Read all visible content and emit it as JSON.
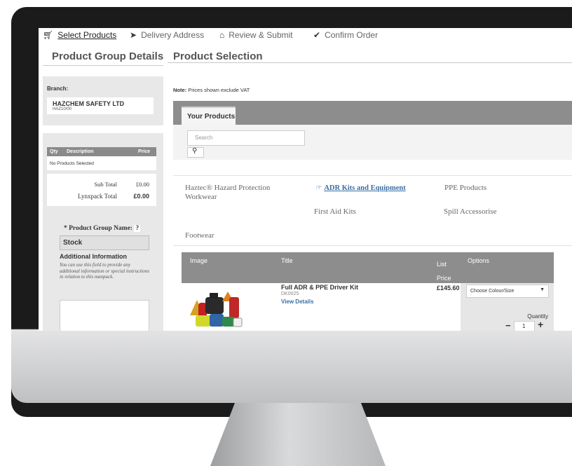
{
  "steps": [
    {
      "label": "Select Products",
      "icon": "cart-icon"
    },
    {
      "label": "Delivery Address",
      "icon": "send-icon"
    },
    {
      "label": "Review & Submit",
      "icon": "basket-icon"
    },
    {
      "label": "Confirm Order",
      "icon": "checkmark-icon"
    }
  ],
  "left": {
    "title": "Product Group Details",
    "branch_label": "Branch:",
    "branch_name": "HAZCHEM SAFETY LTD",
    "branch_code": "HAZ10/00",
    "table_headers": [
      "Qty",
      "Description",
      "Price"
    ],
    "empty_text": "No Products Selected",
    "subtotal_label": "Sub Total",
    "subtotal_value": "£0.00",
    "lynx_label": "Lynxpack Total",
    "lynx_value": "£0.00",
    "group_name_label": "* Product Group Name:",
    "help_mark": "?",
    "group_name_value": "Stock",
    "additional_title": "Additional Information",
    "additional_text": "You can use this field to provide any additional information or special instructions in relation to this manpack."
  },
  "main": {
    "title": "Product Selection",
    "note_bold": "Note:",
    "note_text": "Prices shown exclude VAT",
    "tab": "Your Products",
    "search_placeholder": "Search",
    "search_icon": "search-icon",
    "categories": [
      "Haztec® Hazard Protection Workwear",
      "ADR Kits and Equipment",
      "PPE Products",
      "First Aid Kits",
      "Spill Accessorise",
      "Footwear"
    ],
    "product_headers": [
      "Image",
      "Title",
      "List Price",
      "Options"
    ],
    "product": {
      "name": "Full ADR & PPE Driver Kit",
      "code": "DK0025",
      "details_link": "View Details",
      "price": "£145.60",
      "options_value": "Choose Colour/Size",
      "quantity_label": "Quantity",
      "quantity": "1",
      "minus": "−",
      "plus": "+"
    }
  }
}
